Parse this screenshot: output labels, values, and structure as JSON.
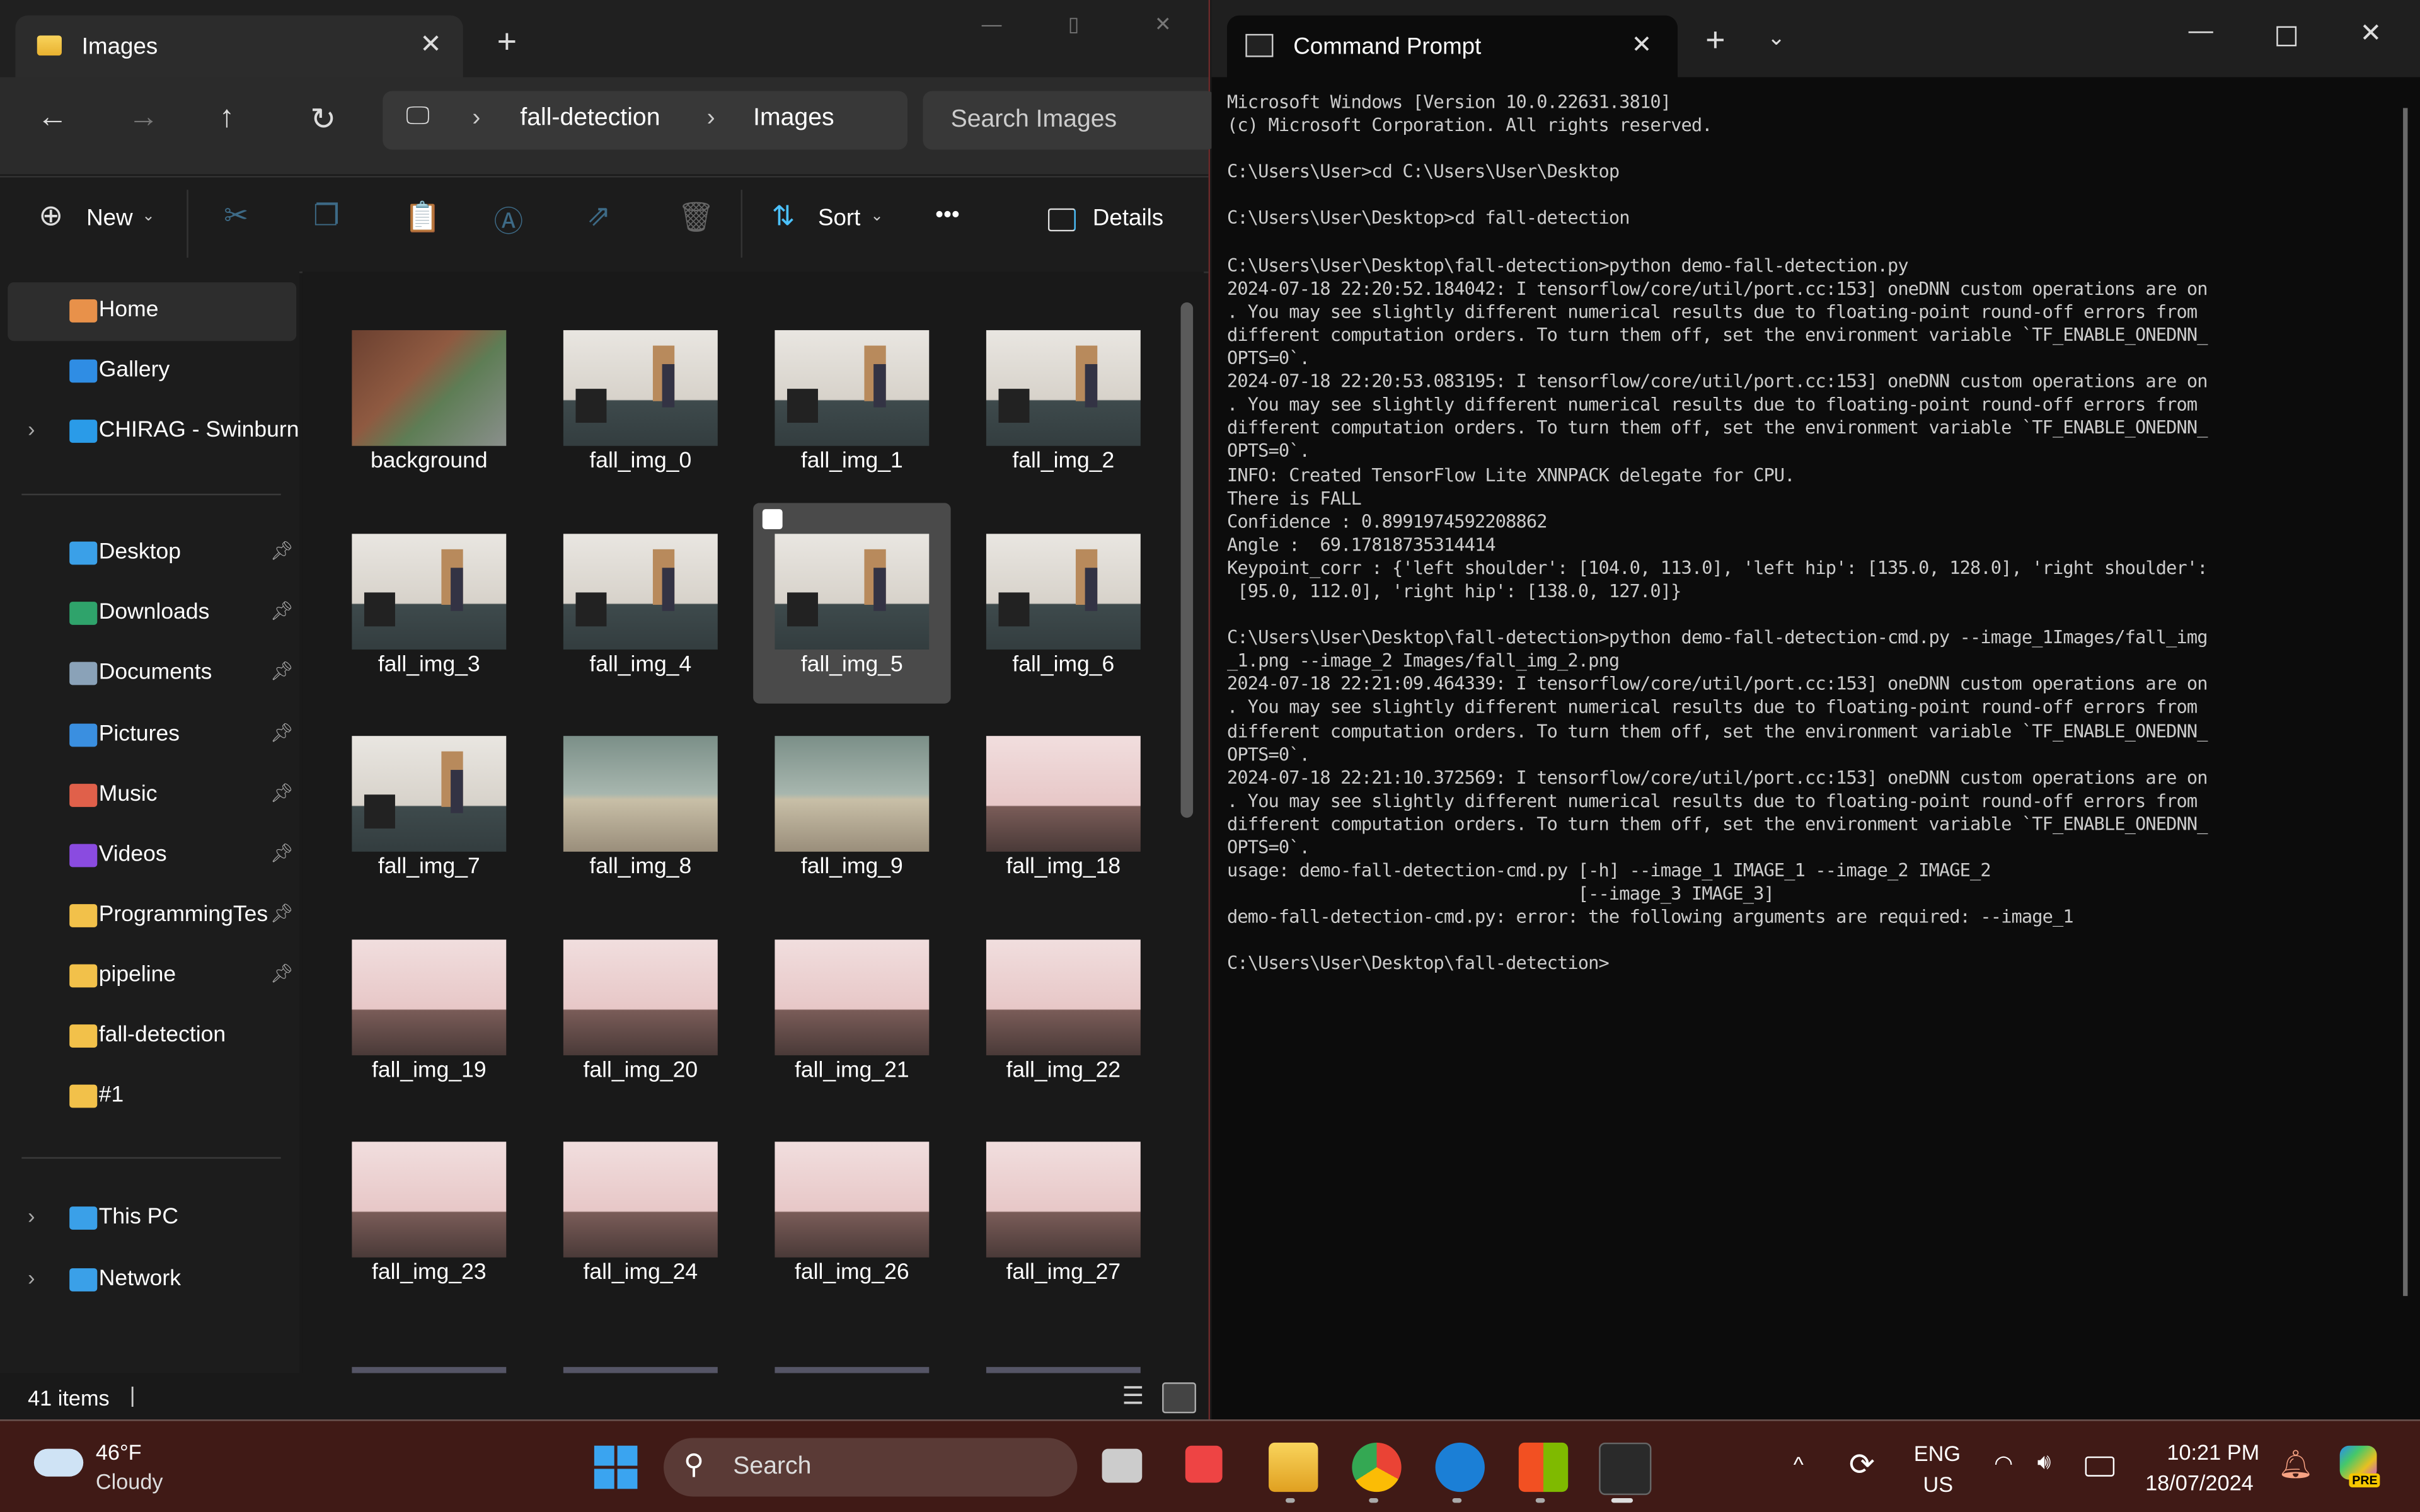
{
  "explorer": {
    "tab_title": "Images",
    "new_tab": "+",
    "window_controls": [
      "minimize",
      "maximize",
      "close"
    ],
    "breadcrumb": [
      "fall-detection",
      "Images"
    ],
    "search_placeholder": "Search Images",
    "toolbar": {
      "new_label": "New",
      "sort_label": "Sort",
      "more_label": "•••",
      "details_label": "Details"
    },
    "sidebar": {
      "top": [
        {
          "label": "Home",
          "icon": "home-icon",
          "color": "#e8914a",
          "selected": true
        },
        {
          "label": "Gallery",
          "icon": "gallery-icon",
          "color": "#2f8de4"
        },
        {
          "label": "CHIRAG - Swinburne",
          "icon": "onedrive-icon",
          "color": "#2a9be8",
          "expandable": true
        }
      ],
      "pinned": [
        {
          "label": "Desktop",
          "icon": "desktop-folder-icon",
          "color": "#3aa0e8"
        },
        {
          "label": "Downloads",
          "icon": "downloads-folder-icon",
          "color": "#2fa36b"
        },
        {
          "label": "Documents",
          "icon": "documents-folder-icon",
          "color": "#8aa2b8"
        },
        {
          "label": "Pictures",
          "icon": "pictures-folder-icon",
          "color": "#3a8fe0"
        },
        {
          "label": "Music",
          "icon": "music-folder-icon",
          "color": "#e0604a"
        },
        {
          "label": "Videos",
          "icon": "videos-folder-icon",
          "color": "#8a4be0"
        },
        {
          "label": "ProgrammingTes",
          "icon": "folder-icon",
          "color": "#f2c14a"
        },
        {
          "label": "pipeline",
          "icon": "folder-icon",
          "color": "#f2c14a"
        }
      ],
      "recent": [
        {
          "label": "fall-detection",
          "icon": "folder-icon",
          "color": "#f2c14a"
        },
        {
          "label": "#1",
          "icon": "folder-icon",
          "color": "#f2c14a"
        }
      ],
      "bottom": [
        {
          "label": "This PC",
          "icon": "pc-icon",
          "color": "#3aa0e8"
        },
        {
          "label": "Network",
          "icon": "network-icon",
          "color": "#3aa0e8"
        }
      ]
    },
    "files": [
      {
        "name": "background",
        "style": "bg"
      },
      {
        "name": "fall_img_0",
        "style": "room"
      },
      {
        "name": "fall_img_1",
        "style": "room"
      },
      {
        "name": "fall_img_2",
        "style": "room"
      },
      {
        "name": "fall_img_3",
        "style": "room"
      },
      {
        "name": "fall_img_4",
        "style": "room"
      },
      {
        "name": "fall_img_5",
        "style": "room",
        "selected": true
      },
      {
        "name": "fall_img_6",
        "style": "room"
      },
      {
        "name": "fall_img_7",
        "style": "room"
      },
      {
        "name": "fall_img_8",
        "style": "green"
      },
      {
        "name": "fall_img_9",
        "style": "green"
      },
      {
        "name": "fall_img_18",
        "style": "red"
      },
      {
        "name": "fall_img_19",
        "style": "red"
      },
      {
        "name": "fall_img_20",
        "style": "red"
      },
      {
        "name": "fall_img_21",
        "style": "red"
      },
      {
        "name": "fall_img_22",
        "style": "red"
      },
      {
        "name": "fall_img_23",
        "style": "red"
      },
      {
        "name": "fall_img_24",
        "style": "red"
      },
      {
        "name": "fall_img_26",
        "style": "red"
      },
      {
        "name": "fall_img_27",
        "style": "red"
      }
    ],
    "status": {
      "item_count": "41 items"
    }
  },
  "terminal": {
    "tab_title": "Command Prompt",
    "lines": [
      "Microsoft Windows [Version 10.0.22631.3810]",
      "(c) Microsoft Corporation. All rights reserved.",
      "",
      "C:\\Users\\User>cd C:\\Users\\User\\Desktop",
      "",
      "C:\\Users\\User\\Desktop>cd fall-detection",
      "",
      "C:\\Users\\User\\Desktop\\fall-detection>python demo-fall-detection.py",
      "2024-07-18 22:20:52.184042: I tensorflow/core/util/port.cc:153] oneDNN custom operations are on",
      ". You may see slightly different numerical results due to floating-point round-off errors from",
      "different computation orders. To turn them off, set the environment variable `TF_ENABLE_ONEDNN_",
      "OPTS=0`.",
      "2024-07-18 22:20:53.083195: I tensorflow/core/util/port.cc:153] oneDNN custom operations are on",
      ". You may see slightly different numerical results due to floating-point round-off errors from",
      "different computation orders. To turn them off, set the environment variable `TF_ENABLE_ONEDNN_",
      "OPTS=0`.",
      "INFO: Created TensorFlow Lite XNNPACK delegate for CPU.",
      "There is FALL",
      "Confidence : 0.8991974592208862",
      "Angle :  69.17818735314414",
      "Keypoint_corr : {'left shoulder': [104.0, 113.0], 'left hip': [135.0, 128.0], 'right shoulder':",
      " [95.0, 112.0], 'right hip': [138.0, 127.0]}",
      "",
      "C:\\Users\\User\\Desktop\\fall-detection>python demo-fall-detection-cmd.py --image_1Images/fall_img",
      "_1.png --image_2 Images/fall_img_2.png",
      "2024-07-18 22:21:09.464339: I tensorflow/core/util/port.cc:153] oneDNN custom operations are on",
      ". You may see slightly different numerical results due to floating-point round-off errors from",
      "different computation orders. To turn them off, set the environment variable `TF_ENABLE_ONEDNN_",
      "OPTS=0`.",
      "2024-07-18 22:21:10.372569: I tensorflow/core/util/port.cc:153] oneDNN custom operations are on",
      ". You may see slightly different numerical results due to floating-point round-off errors from",
      "different computation orders. To turn them off, set the environment variable `TF_ENABLE_ONEDNN_",
      "OPTS=0`.",
      "usage: demo-fall-detection-cmd.py [-h] --image_1 IMAGE_1 --image_2 IMAGE_2",
      "                                  [--image_3 IMAGE_3]",
      "demo-fall-detection-cmd.py: error: the following arguments are required: --image_1",
      "",
      "C:\\Users\\User\\Desktop\\fall-detection>"
    ]
  },
  "taskbar": {
    "weather": {
      "temp": "46°F",
      "condition": "Cloudy"
    },
    "search_label": "Search",
    "apps": [
      "start",
      "search",
      "task-view",
      "snipping-tool",
      "file-explorer",
      "chrome",
      "app",
      "store",
      "terminal"
    ],
    "tray": {
      "lang_top": "ENG",
      "lang_bottom": "US",
      "time": "10:21 PM",
      "date": "18/07/2024",
      "copilot_badge": "PRE"
    }
  }
}
